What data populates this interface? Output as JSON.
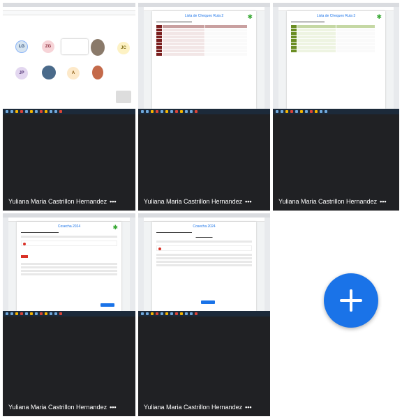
{
  "participants": [
    {
      "name": "Yuliana Maria Castrillon Hernandez",
      "more": "•••"
    },
    {
      "name": "Yuliana Maria Castrillon Hernandez",
      "more": "•••"
    },
    {
      "name": "Yuliana Maria Castrillon Hernandez",
      "more": "•••"
    },
    {
      "name": "Yuliana Maria Castrillon Hernandez",
      "more": "•••"
    },
    {
      "name": "Yuliana Maria Castrillon Hernandez",
      "more": "•••"
    }
  ],
  "meeting_avatars": [
    {
      "initials": "LG",
      "color": "#d6e4f0",
      "text": "#1a3d6d"
    },
    {
      "initials": "ZG",
      "color": "#f7d4d8",
      "text": "#8a2b3a"
    },
    {
      "initials": "JP",
      "color": "#e3d7f0",
      "text": "#5a3d7d"
    },
    {
      "initials": "A",
      "color": "#fde9c9",
      "text": "#8a5a10"
    },
    {
      "initials": "JC",
      "color": "#fdf2c4",
      "text": "#7d6a10"
    }
  ],
  "tile2": {
    "title": "Lista de Chequeo Ruta 2"
  },
  "tile3": {
    "title": "Lista de Chequeo Ruta 3"
  },
  "tile4": {
    "title": "Cosecha 2024"
  },
  "tile5": {
    "title": "Cosecha 2024"
  },
  "fab": {
    "icon": "plus-icon",
    "color": "#1a73e8"
  }
}
